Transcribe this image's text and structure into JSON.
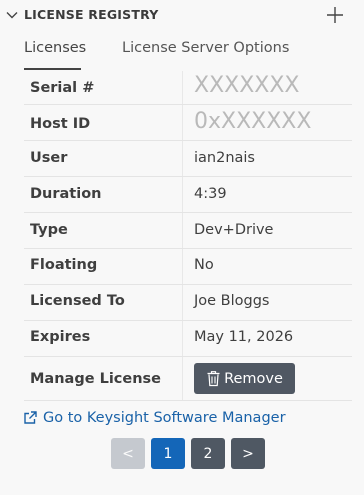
{
  "header": {
    "title": "LICENSE REGISTRY"
  },
  "tabs": [
    {
      "label": "Licenses"
    },
    {
      "label": "License Server Options"
    }
  ],
  "fields": {
    "serial": {
      "label": "Serial #",
      "placeholder": "XXXXXXX"
    },
    "host_id": {
      "label": "Host ID",
      "placeholder": "0xXXXXXX"
    },
    "user": {
      "label": "User",
      "value": "ian2nais"
    },
    "duration": {
      "label": "Duration",
      "value": "4:39"
    },
    "type": {
      "label": "Type",
      "value": "Dev+Drive"
    },
    "floating": {
      "label": "Floating",
      "value": "No"
    },
    "licensed_to": {
      "label": "Licensed To",
      "value": "Joe Bloggs"
    },
    "expires": {
      "label": "Expires",
      "value": "May 11, 2026"
    },
    "manage": {
      "label": "Manage License",
      "button_label": "Remove"
    }
  },
  "link": {
    "label": "Go to Keysight Software Manager"
  },
  "pagination": {
    "prev": "<",
    "pages": [
      "1",
      "2"
    ],
    "next": ">",
    "current": "1"
  },
  "colors": {
    "accent": "#1466b8",
    "button_dark": "#4f5863",
    "link": "#1a62a8"
  }
}
